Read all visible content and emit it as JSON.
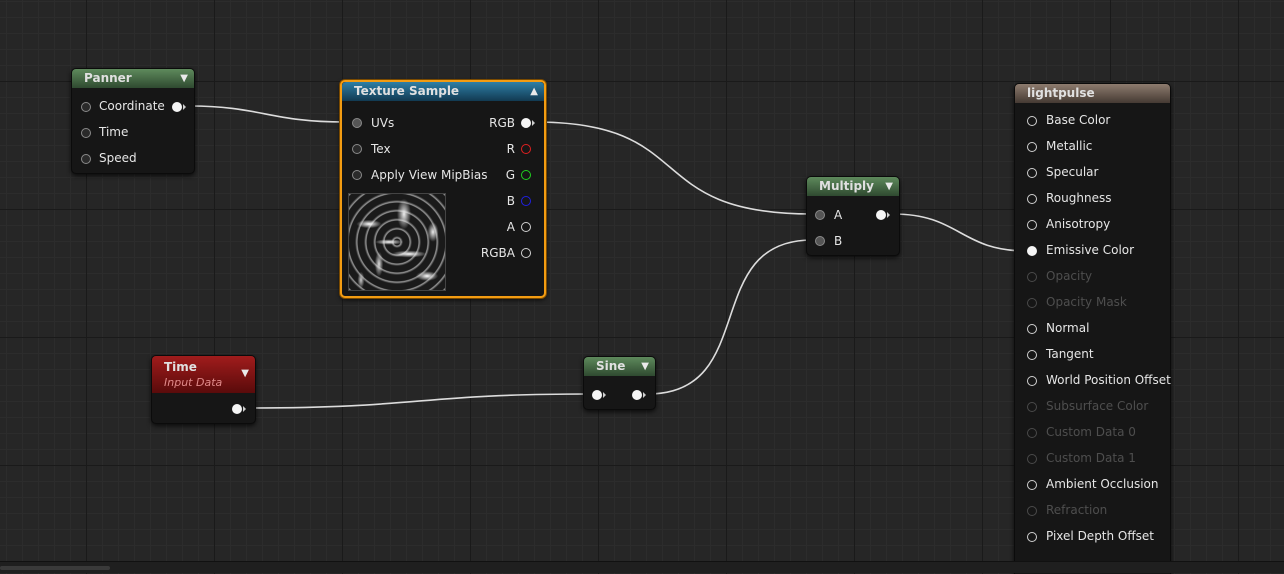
{
  "nodes": {
    "panner": {
      "title": "Panner",
      "pins": [
        "Coordinate",
        "Time",
        "Speed"
      ]
    },
    "texture_sample": {
      "title": "Texture Sample",
      "inputs": [
        "UVs",
        "Tex",
        "Apply View MipBias"
      ],
      "outputs": [
        "RGB",
        "R",
        "G",
        "B",
        "A",
        "RGBA"
      ]
    },
    "time": {
      "title": "Time",
      "subtitle": "Input Data"
    },
    "sine": {
      "title": "Sine"
    },
    "multiply": {
      "title": "Multiply",
      "inputs": [
        "A",
        "B"
      ]
    },
    "material": {
      "title": "lightpulse",
      "pins": [
        {
          "label": "Base Color",
          "enabled": true
        },
        {
          "label": "Metallic",
          "enabled": true
        },
        {
          "label": "Specular",
          "enabled": true
        },
        {
          "label": "Roughness",
          "enabled": true
        },
        {
          "label": "Anisotropy",
          "enabled": true
        },
        {
          "label": "Emissive Color",
          "enabled": true
        },
        {
          "label": "Opacity",
          "enabled": false
        },
        {
          "label": "Opacity Mask",
          "enabled": false
        },
        {
          "label": "Normal",
          "enabled": true
        },
        {
          "label": "Tangent",
          "enabled": true
        },
        {
          "label": "World Position Offset",
          "enabled": true
        },
        {
          "label": "Subsurface Color",
          "enabled": false
        },
        {
          "label": "Custom Data 0",
          "enabled": false
        },
        {
          "label": "Custom Data 1",
          "enabled": false
        },
        {
          "label": "Ambient Occlusion",
          "enabled": true
        },
        {
          "label": "Refraction",
          "enabled": false
        },
        {
          "label": "Pixel Depth Offset",
          "enabled": true
        }
      ]
    }
  },
  "colors": {
    "selection": "#f39c12",
    "pin_r": "#e02020",
    "pin_g": "#20d020",
    "pin_b": "#2020e0"
  }
}
